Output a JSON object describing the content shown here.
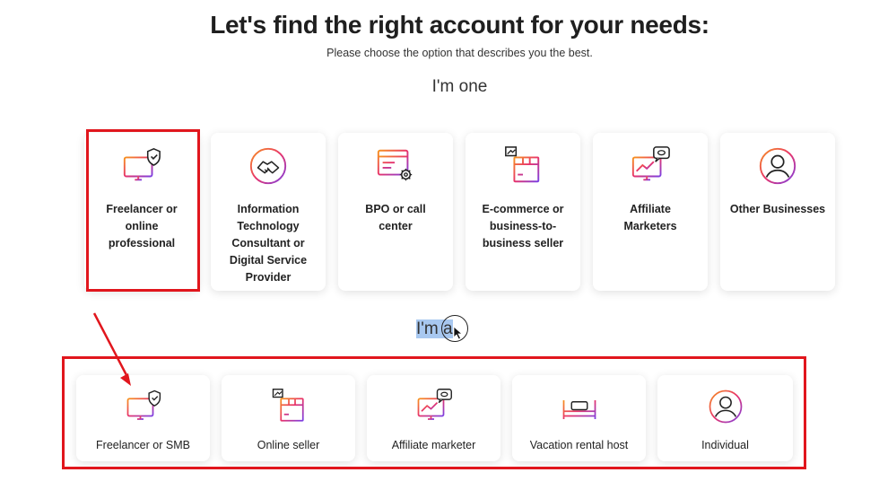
{
  "page": {
    "title": "Let's find the right account for your needs:",
    "subtitle": "Please choose the option that describes you the best.",
    "section_one": "I'm one"
  },
  "section_two": {
    "prefix": "I'm ",
    "selected": "a"
  },
  "top_cards": [
    {
      "label": "Freelancer or online professional",
      "icon": "monitor-shield-icon"
    },
    {
      "label": "Information Technology Consultant or Digital Service Provider",
      "icon": "handshake-icon"
    },
    {
      "label": "BPO or call center",
      "icon": "browser-gear-icon"
    },
    {
      "label": "E-commerce or business-to-business seller",
      "icon": "box-chart-icon"
    },
    {
      "label": "Affiliate Marketers",
      "icon": "monitor-chat-icon"
    },
    {
      "label": "Other Businesses",
      "icon": "user-circle-icon"
    }
  ],
  "bottom_cards": [
    {
      "label": "Freelancer or SMB",
      "icon": "monitor-shield-icon"
    },
    {
      "label": "Online seller",
      "icon": "box-chart-icon"
    },
    {
      "label": "Affiliate marketer",
      "icon": "monitor-chat-icon"
    },
    {
      "label": "Vacation rental host",
      "icon": "bed-icon"
    },
    {
      "label": "Individual",
      "icon": "user-circle-icon"
    }
  ],
  "colors": {
    "highlight": "#e1161d",
    "icon_gradient_start": "#f7931e",
    "icon_gradient_end": "#7b3fe4",
    "text_selection": "#a8c8f0"
  }
}
